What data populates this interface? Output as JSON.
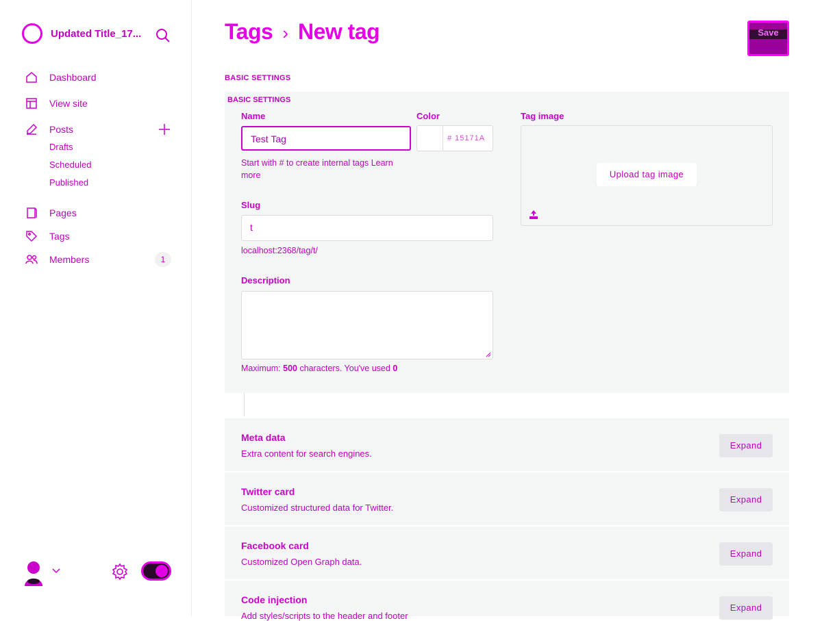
{
  "sidebar": {
    "site_title": "Updated Title_17...",
    "nav": [
      {
        "key": "dashboard",
        "label": "Dashboard",
        "icon": "home-icon"
      },
      {
        "key": "view-site",
        "label": "View site",
        "icon": "layout-icon"
      },
      {
        "key": "posts",
        "label": "Posts",
        "icon": "edit-icon"
      },
      {
        "key": "pages",
        "label": "Pages",
        "icon": "page-icon"
      },
      {
        "key": "tags",
        "label": "Tags",
        "icon": "tag-icon"
      },
      {
        "key": "members",
        "label": "Members",
        "icon": "members-icon"
      }
    ],
    "post_subitems": [
      "Drafts",
      "Scheduled",
      "Published"
    ],
    "members_count": "1"
  },
  "header": {
    "breadcrumb_parent": "Tags",
    "breadcrumb_separator": "›",
    "breadcrumb_current": "New tag",
    "save_label": "Save"
  },
  "basic_settings": {
    "section_label": "BASIC SETTINGS",
    "name_label": "Name",
    "name_value": "Test Tag",
    "name_hint": "Start with # to create internal tags",
    "name_hint_link": "Learn more",
    "color_label": "Color",
    "color_value": "# 15171A",
    "slug_label": "Slug",
    "slug_value": "t",
    "slug_url": "localhost:2368/tag/t/",
    "description_label": "Description",
    "description_hint_prefix": "Maximum:",
    "description_max": "500",
    "description_hint_mid": "characters. You've used",
    "description_used": "0",
    "tag_image_label": "Tag image",
    "upload_label": "Upload tag image"
  },
  "accordions": [
    {
      "title": "Meta data",
      "description": "Extra content for search engines.",
      "button": "Expand"
    },
    {
      "title": "Twitter card",
      "description": "Customized structured data for Twitter.",
      "button": "Expand"
    },
    {
      "title": "Facebook card",
      "description": "Customized Open Graph data.",
      "button": "Expand"
    },
    {
      "title": "Code injection",
      "description": "Add styles/scripts to the header and footer",
      "button": "Expand"
    }
  ],
  "colors": {
    "accent": "#cc00cc",
    "panel_bg": "#f4f5f5",
    "tag_color": "#15171A"
  }
}
